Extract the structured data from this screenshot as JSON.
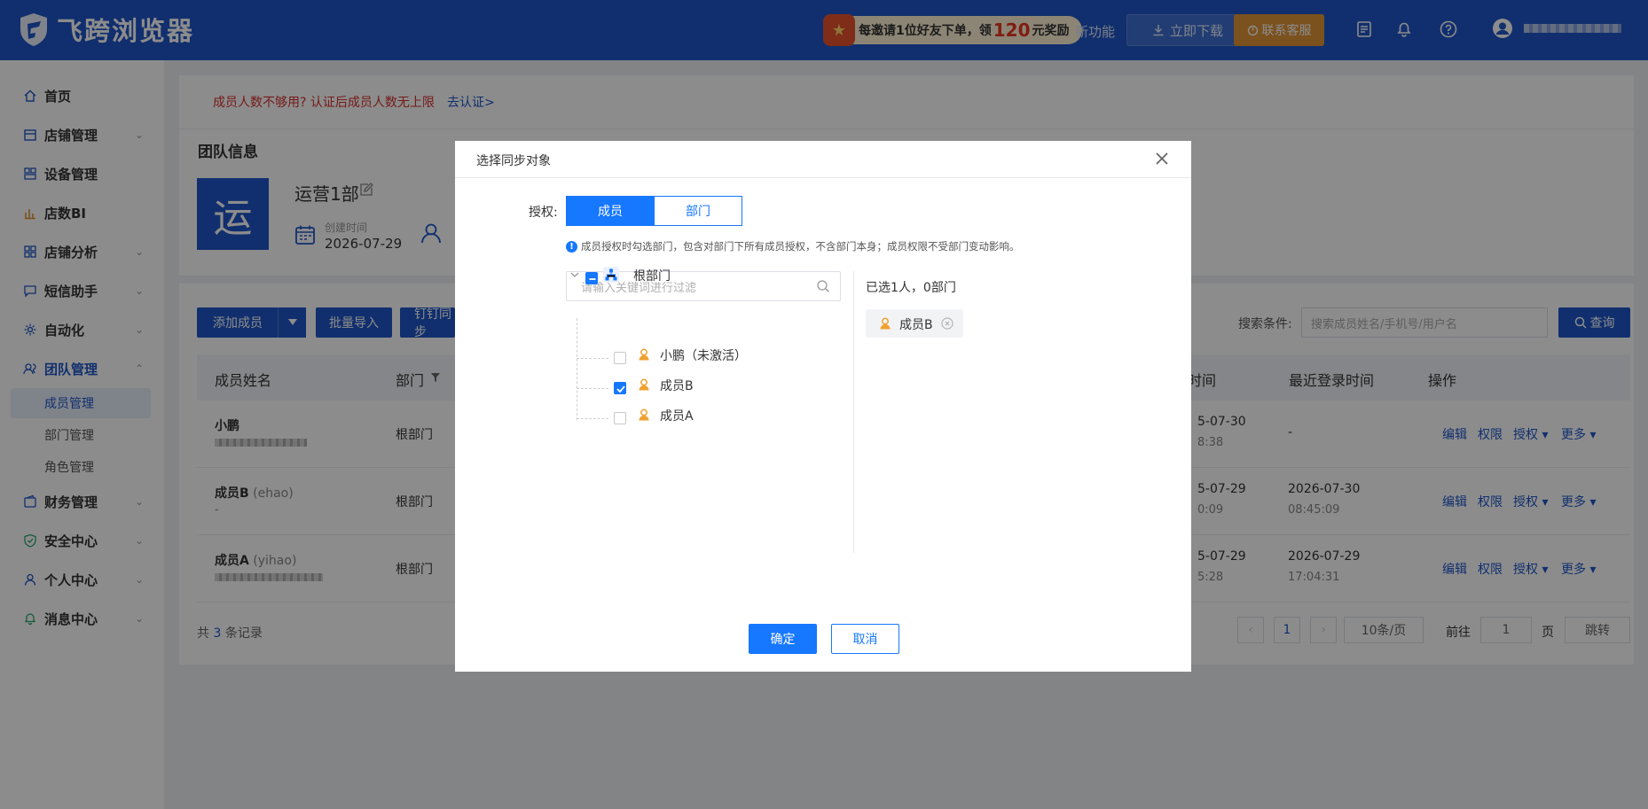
{
  "topbar": {
    "app_title": "飞跨浏览器",
    "promo": {
      "prefix": "每邀请1位好友下单，领",
      "amount": "120",
      "suffix": "元奖励"
    },
    "new_feature": "新功能",
    "download": "立即下载",
    "customer_service": "联系客服",
    "icons": [
      "doc-icon",
      "bell-icon",
      "help-icon",
      "user-circle-icon"
    ]
  },
  "sidebar": {
    "items": [
      {
        "label": "首页",
        "icon": "home-icon"
      },
      {
        "label": "店铺管理",
        "icon": "store-icon"
      },
      {
        "label": "设备管理",
        "icon": "device-icon"
      },
      {
        "label": "店数BI",
        "icon": "chart-icon"
      },
      {
        "label": "店铺分析",
        "icon": "grid-icon"
      },
      {
        "label": "短信助手",
        "icon": "message-icon"
      },
      {
        "label": "自动化",
        "icon": "gear-icon"
      },
      {
        "label": "团队管理",
        "icon": "team-icon"
      },
      {
        "label": "财务管理",
        "icon": "wallet-icon"
      },
      {
        "label": "安全中心",
        "icon": "shield-icon"
      },
      {
        "label": "个人中心",
        "icon": "person-icon"
      },
      {
        "label": "消息中心",
        "icon": "bell-icon"
      }
    ],
    "subitems": [
      "成员管理",
      "部门管理",
      "角色管理"
    ]
  },
  "main": {
    "notice": "成员人数不够用? 认证后成员人数无上限",
    "notice_link": "去认证>",
    "team_section_title": "团队信息",
    "team_avatar_char": "运",
    "team_name": "运营1部",
    "created_label": "创建时间",
    "created_date": "2026-07-29",
    "buttons": {
      "add_member": "添加成员",
      "batch_import": "批量导入",
      "dingding": "钉钉同步"
    },
    "search_label": "搜索条件:",
    "search_placeholder": "搜索成员姓名/手机号/用户名",
    "query": "查询",
    "table": {
      "headers": [
        "成员姓名",
        "部门",
        "时间",
        "最近登录时间",
        "操作"
      ],
      "rows": [
        {
          "name": "小鹏",
          "username": "",
          "dept": "根部门",
          "time1": "5-07-30",
          "time2": "8:38",
          "login1": "-",
          "login2": ""
        },
        {
          "name": "成员B",
          "username": " (ehao)",
          "dept": "根部门",
          "time1": "5-07-29",
          "time2": "0:09",
          "login1": "2026-07-30",
          "login2": "08:45:09",
          "sub": "-"
        },
        {
          "name": "成员A",
          "username": " (yihao)",
          "dept": "根部门",
          "time1": "5-07-29",
          "time2": "5:28",
          "login1": "2026-07-29",
          "login2": "17:04:31"
        }
      ],
      "ops": [
        "编辑",
        "权限",
        "授权 ▾",
        "更多 ▾"
      ]
    },
    "footer": {
      "prefix": "共 ",
      "count": "3",
      "suffix": " 条记录"
    },
    "pagination": {
      "page": "1",
      "page_size": "10条/页",
      "goto_label": "前往",
      "goto_value": "1",
      "page_label": "页",
      "jump": "跳转"
    }
  },
  "modal": {
    "title": "选择同步对象",
    "auth_label": "授权:",
    "tabs": {
      "active": "成员",
      "inactive": "部门"
    },
    "hint": "成员授权时勾选部门，包含对部门下所有成员授权，不含部门本身；成员权限不受部门变动影响。",
    "filter_placeholder": "请输入关键词进行过滤",
    "tree": {
      "root": "根部门",
      "children": [
        {
          "label": "小鹏（未激活）",
          "checked": false
        },
        {
          "label": "成员B",
          "checked": true
        },
        {
          "label": "成员A",
          "checked": false
        }
      ]
    },
    "selected_summary": "已选1人，0部门",
    "selected_tags": [
      "成员B"
    ],
    "confirm": "确定",
    "cancel": "取消"
  },
  "colors": {
    "brand": "#1f57c8",
    "accent": "#1677ff",
    "warning": "#d8302f",
    "member": "#f0a02e"
  }
}
